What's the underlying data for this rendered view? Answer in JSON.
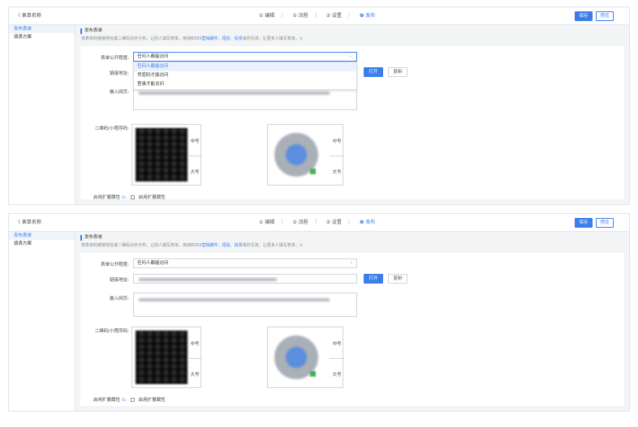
{
  "colors": {
    "accent": "#3b7de9",
    "panel_bg": "#f3f4f6"
  },
  "header": {
    "back_label": "〈 表单名称",
    "steps": [
      "① 编辑",
      "② 流程",
      "③ 设置",
      "❹ 发布"
    ],
    "save_label": "保存",
    "preview_label": "预览"
  },
  "sidebar": {
    "items": [
      "发布表单",
      "填表方案"
    ]
  },
  "section": {
    "title": "发布表单",
    "desc_prefix": "将表单的链接地址或二维码对外分布，让别人填写表单。用淘BOSS",
    "desc_link1": "营销邮件",
    "desc_mid1": "、",
    "desc_link2": "短信",
    "desc_mid2": "、",
    "desc_link3": "投票",
    "desc_suffix": "来你引流，让更多人填写表单。⊙"
  },
  "form": {
    "visibility_label": "表单公开程度:",
    "visibility_value": "任何人都能访问",
    "link_label": "链接地址:",
    "embed_label": "嵌入网页:",
    "open_label": "打开",
    "copy_label": "复制",
    "qr_label": "二维码/小程序码:",
    "qr_medium": "中号",
    "qr_large": "大号",
    "ext_label": "启用扩展属性",
    "ext_help": "⊙:",
    "ext_checkbox_label": "启用扩展属性"
  },
  "dropdown": {
    "options": [
      "任何人都能访问",
      "凭密码才能访问",
      "登录才能访问"
    ],
    "selected_index": 0
  }
}
